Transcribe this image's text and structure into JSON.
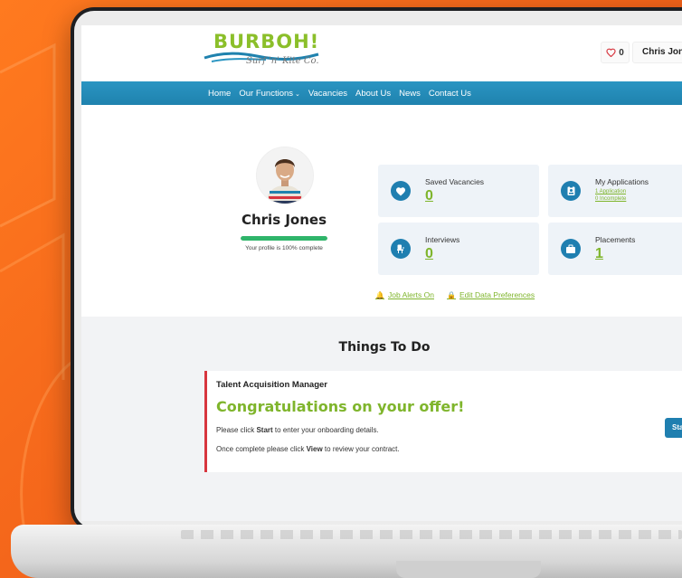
{
  "colors": {
    "background_orange": "#f2621a",
    "nav_blue": "#1f82ae",
    "accent_green": "#7fb52c",
    "progress_green": "#2fb56a",
    "alert_red": "#d7353e",
    "icon_blue": "#1f7fb0"
  },
  "header": {
    "logo_text": "BURBOH!",
    "logo_tagline": "Surf 'n' Kite Co.",
    "favourites_icon": "heart-outline-icon",
    "favourites_count": "0",
    "user_name": "Chris Jones"
  },
  "nav": {
    "items": [
      {
        "label": "Home"
      },
      {
        "label": "Our Functions",
        "dropdown_icon": "chevron-down-icon"
      },
      {
        "label": "Vacancies"
      },
      {
        "label": "About Us"
      },
      {
        "label": "News"
      },
      {
        "label": "Contact Us"
      }
    ]
  },
  "profile": {
    "name": "Chris Jones",
    "completion_percent": 100,
    "status_text": "Your profile is 100% complete"
  },
  "cards": [
    {
      "title": "Saved Vacancies",
      "value": "0",
      "icon": "heart-icon"
    },
    {
      "title": "My Applications",
      "value": "",
      "icon": "id-badge-icon",
      "links": [
        "1 Application",
        "0 Incomplete"
      ]
    },
    {
      "title": "Interviews",
      "value": "0",
      "icon": "interview-chair-icon"
    },
    {
      "title": "Placements",
      "value": "1",
      "icon": "briefcase-icon"
    }
  ],
  "preferences": {
    "job_alerts": "Job Alerts On",
    "job_alerts_icon": "bell-icon",
    "data_prefs": "Edit Data Preferences",
    "data_prefs_icon": "lock-icon"
  },
  "todo": {
    "heading": "Things To Do",
    "job_title": "Talent Acquisition Manager",
    "headline": "Congratulations on your offer!",
    "line1_pre": "Please click ",
    "line1_bold": "Start",
    "line1_post": " to enter your onboarding details.",
    "line2_pre": "Once complete please click ",
    "line2_bold": "View",
    "line2_post": " to review your contract.",
    "start_button": "Start"
  }
}
